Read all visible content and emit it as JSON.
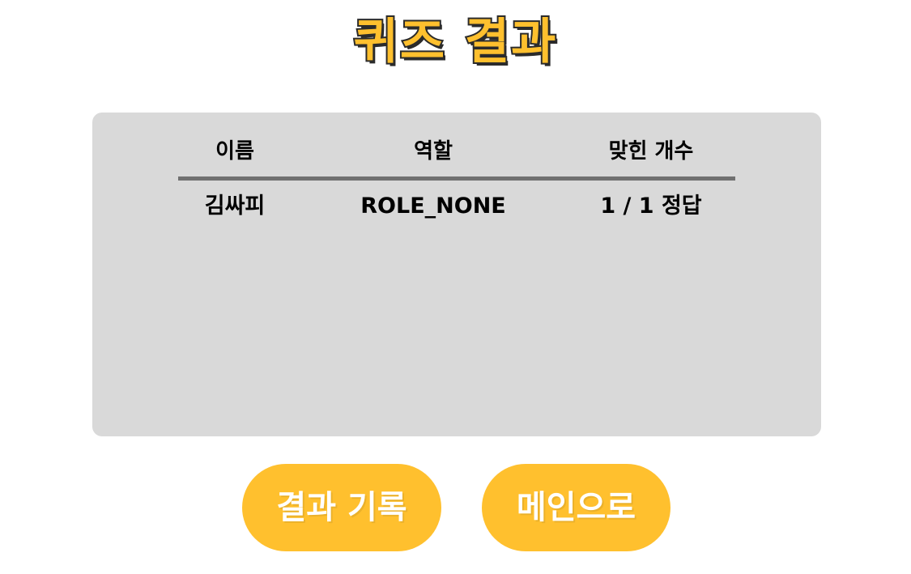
{
  "title": "퀴즈 결과",
  "table": {
    "headers": {
      "name": "이름",
      "role": "역할",
      "correct": "맞힌 개수"
    },
    "rows": [
      {
        "name": "김싸피",
        "role": "ROLE_NONE",
        "correct": "1 / 1 정답"
      }
    ]
  },
  "buttons": {
    "record": "결과 기록",
    "main": "메인으로"
  },
  "colors": {
    "accent": "#FFC02E",
    "panel": "#D9D9D9",
    "divider": "#707070",
    "title_outline": "#2B2B2B"
  }
}
